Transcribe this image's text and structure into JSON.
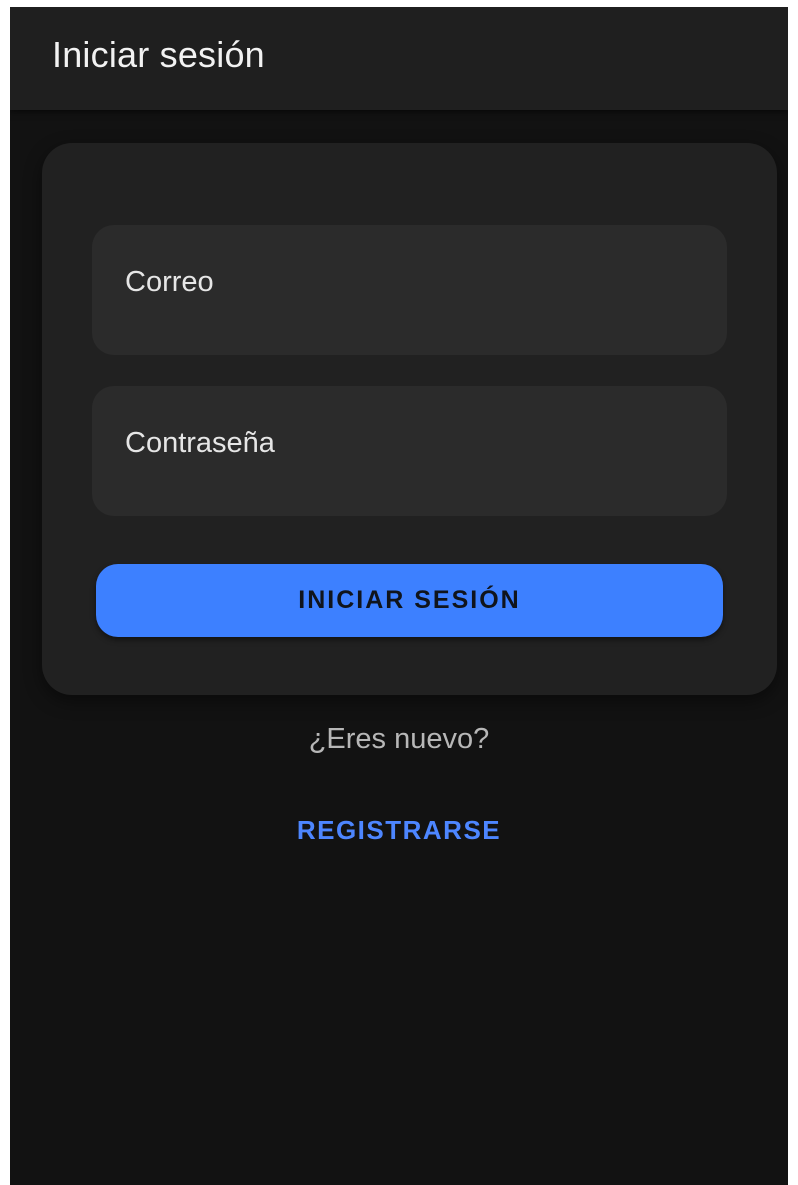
{
  "appbar": {
    "title": "Iniciar sesión"
  },
  "form": {
    "email_label": "Correo",
    "password_label": "Contraseña",
    "submit_label": "INICIAR SESIÓN"
  },
  "footer": {
    "prompt": "¿Eres nuevo?",
    "register_label": "REGISTRARSE"
  },
  "colors": {
    "background": "#121212",
    "appbar": "#1f1f1f",
    "card": "#212121",
    "field": "#2b2b2b",
    "accent": "#3d80ff",
    "link": "#4d86ff"
  }
}
